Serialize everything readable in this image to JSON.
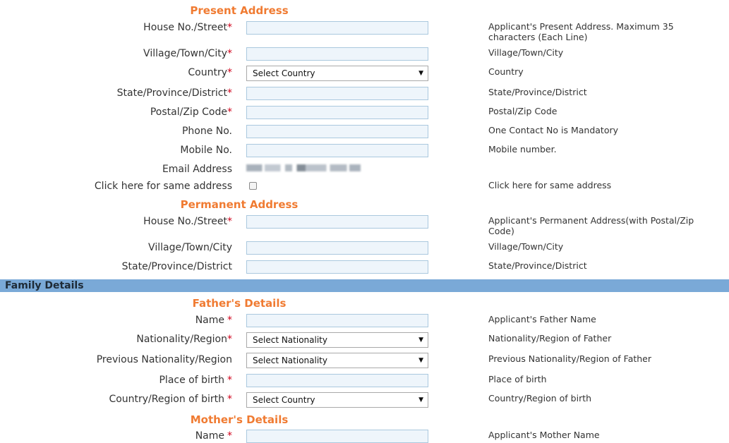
{
  "present": {
    "title": "Present Address",
    "house_label": "House No./Street",
    "house_help": "Applicant's Present Address. Maximum 35 characters (Each Line)",
    "village_label": "Village/Town/City",
    "village_help": "Village/Town/City",
    "country_label": "Country",
    "country_value": "Select Country",
    "country_help": "Country",
    "state_label": "State/Province/District",
    "state_help": "State/Province/District",
    "postal_label": "Postal/Zip Code",
    "postal_help": "Postal/Zip Code",
    "phone_label": "Phone No.",
    "phone_help": "One Contact No is Mandatory",
    "mobile_label": "Mobile No.",
    "mobile_help": "Mobile number.",
    "email_label": "Email Address",
    "same_label": "Click here for same address",
    "same_help": "Click here for same address"
  },
  "permanent": {
    "title": "Permanent Address",
    "house_label": "House No./Street",
    "house_help": "Applicant's Permanent Address(with Postal/Zip Code)",
    "village_label": "Village/Town/City",
    "village_help": "Village/Town/City",
    "state_label": "State/Province/District",
    "state_help": "State/Province/District"
  },
  "family": {
    "bar_title": "Family Details"
  },
  "father": {
    "title": "Father's Details",
    "name_label": "Name",
    "name_help": "Applicant's Father Name",
    "nationality_label": "Nationality/Region",
    "nationality_value": "Select Nationality",
    "nationality_help": "Nationality/Region of Father",
    "prev_nationality_label": "Previous Nationality/Region",
    "prev_nationality_value": "Select Nationality",
    "prev_nationality_help": "Previous Nationality/Region of Father",
    "birthplace_label": "Place of birth",
    "birthplace_help": "Place of birth",
    "birthcountry_label": "Country/Region of birth",
    "birthcountry_value": "Select Country",
    "birthcountry_help": "Country/Region of birth"
  },
  "mother": {
    "title": "Mother's Details",
    "name_label": "Name",
    "name_help": "Applicant's Mother Name"
  },
  "ui": {
    "required_mark": "*",
    "dropdown_arrow": "▼"
  },
  "colors": {
    "section_title": "#f07b32",
    "required": "#d0021b",
    "bar_bg": "#7aa9d7",
    "input_bg": "#eef5fb",
    "input_border": "#aac8de"
  }
}
